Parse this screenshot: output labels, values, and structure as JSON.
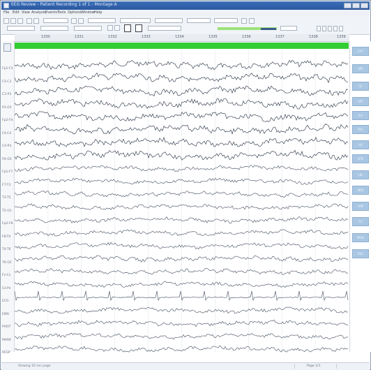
{
  "window": {
    "title": "EEG Review - Patient Recording 1 of 1 - Montage A",
    "titlebar_color": "#2f61a8"
  },
  "menu": {
    "items": [
      "File",
      "Edit",
      "View",
      "Analysis",
      "Events",
      "Tools",
      "Options",
      "Window",
      "Help"
    ]
  },
  "toolbar": {
    "icons": [
      "open-icon",
      "save-icon",
      "print-icon",
      "play-icon",
      "stop-icon",
      "zoom-icon",
      "cursor-icon",
      "marker-icon"
    ],
    "indicator_color": "#9be27a"
  },
  "timescale": {
    "ticks": [
      "1330",
      "1331",
      "1332",
      "1333",
      "1334",
      "1335",
      "1336",
      "1337",
      "1338",
      "1339"
    ]
  },
  "epoch": {
    "color": "#32cd32"
  },
  "channels": [
    "Fp1-F3",
    "F3-C3",
    "C3-P3",
    "P3-O1",
    "Fp2-F4",
    "F4-C4",
    "C4-P4",
    "P4-O2",
    "Fp1-F7",
    "F7-T3",
    "T3-T5",
    "T5-O1",
    "Fp2-F8",
    "F8-T4",
    "T4-T6",
    "T6-O2",
    "Fz-Cz",
    "Cz-Pz",
    "ECG",
    "EMG",
    "PHOT",
    "MARK",
    "RESP"
  ],
  "right_panel": {
    "buttons": [
      "EVT",
      "SPK",
      "SZ",
      "ART",
      "SLP",
      "PHS",
      "HV",
      "NTE",
      "LBL",
      "MRK",
      "AMP",
      "FLT",
      "MON",
      "REV"
    ],
    "button_color": "#a9c6e3"
  },
  "status": {
    "left_text": "Viewing 10 sec page",
    "right_text": "Page 1/1"
  }
}
